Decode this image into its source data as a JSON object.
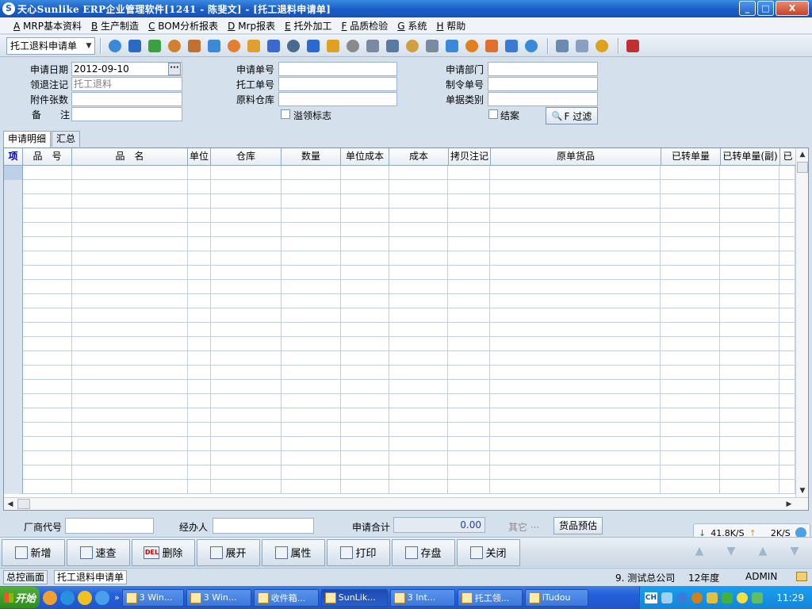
{
  "window": {
    "title": "天心Sunlike ERP企业管理软件[1241 - 陈斐文] - [托工退料申请单]",
    "minimize": "_",
    "maximize": "□",
    "close": "X"
  },
  "menu": [
    {
      "key": "A",
      "label": "MRP基本资料"
    },
    {
      "key": "B",
      "label": "生产制造"
    },
    {
      "key": "C",
      "label": "BOM分析报表"
    },
    {
      "key": "D",
      "label": "Mrp报表"
    },
    {
      "key": "E",
      "label": "托外加工"
    },
    {
      "key": "F",
      "label": "品质检验"
    },
    {
      "key": "G",
      "label": "系统"
    },
    {
      "key": "H",
      "label": "帮助"
    }
  ],
  "toolbar": {
    "form_select": "托工退料申请单",
    "icons": [
      "tree-icon",
      "monitor-icon",
      "phone-icon",
      "user-icon",
      "briefcase-icon",
      "home-icon",
      "users-icon",
      "folder-icon",
      "book-icon",
      "key-icon",
      "help-icon",
      "dollar-icon",
      "cart-icon",
      "document-icon",
      "grid-icon",
      "box-icon",
      "copy-icon",
      "check-icon",
      "bell-icon",
      "hierarchy-icon",
      "screen-icon",
      "refresh-icon",
      "window-icon",
      "close-window-icon",
      "tiles-icon",
      "exit-icon"
    ]
  },
  "form": {
    "apply_date_label": "申请日期",
    "apply_date": "2012-09-10",
    "return_note_label": "领退注记",
    "return_note": "托工退料",
    "attachments_label": "附件张数",
    "attachments": "",
    "remarks_label": "备　　注",
    "remarks": "",
    "apply_no_label": "申请单号",
    "apply_no": "",
    "outsource_no_label": "托工单号",
    "outsource_no": "",
    "material_wh_label": "原料仓库",
    "material_wh": "",
    "over_flag_label": "溢领标志",
    "dept_label": "申请部门",
    "dept": "",
    "order_no_label": "制令单号",
    "order_no": "",
    "doc_type_label": "单据类别",
    "doc_type": "",
    "closed_label": "结案",
    "filter_label": "F 过滤"
  },
  "tabs": [
    "申请明细",
    "汇总"
  ],
  "grid": {
    "columns": [
      "项",
      "品　号",
      "品　名",
      "单位",
      "仓库",
      "数量",
      "单位成本",
      "成本",
      "拷贝注记",
      "原单货品",
      "已转单量",
      "已转单量(副)",
      "已"
    ],
    "row_count": 23
  },
  "footer": {
    "vendor_label": "厂商代号",
    "vendor": "",
    "handler_label": "经办人",
    "handler": "",
    "total_label": "申请合计",
    "total": "0.00",
    "other_label": "其它 ···",
    "estimate_label": "货品预估"
  },
  "actions": [
    {
      "label": "新增",
      "icon": "add-icon"
    },
    {
      "label": "速查",
      "icon": "search-icon"
    },
    {
      "label": "删除",
      "icon": "delete-icon",
      "prefix": "DEL"
    },
    {
      "label": "展开",
      "icon": "expand-icon"
    },
    {
      "label": "属性",
      "icon": "properties-icon"
    },
    {
      "label": "打印",
      "icon": "print-icon"
    },
    {
      "label": "存盘",
      "icon": "save-icon"
    },
    {
      "label": "关闭",
      "icon": "close-icon"
    }
  ],
  "netspeed": {
    "down": "41.8K/S",
    "up": "2K/S"
  },
  "statusbar": {
    "tab1": "总控画面",
    "tab2": "托工退料申请单",
    "company": "9. 测试总公司",
    "year": "12年度",
    "user": "ADMIN"
  },
  "taskbar": {
    "start": "开始",
    "tasks": [
      {
        "label": "3 Win...",
        "active": false
      },
      {
        "label": "3 Win...",
        "active": false
      },
      {
        "label": "收件箱...",
        "active": false
      },
      {
        "label": "SunLik...",
        "active": true
      },
      {
        "label": "3 Int...",
        "active": false
      },
      {
        "label": "托工领...",
        "active": false
      },
      {
        "label": "iTudou",
        "active": false
      }
    ],
    "ime": "CH",
    "clock": "11:29"
  },
  "colors": {
    "titlebar": "#1c5fc9",
    "accent_blue": "#1f3fb5",
    "form_bg": "#d4e0ec"
  }
}
